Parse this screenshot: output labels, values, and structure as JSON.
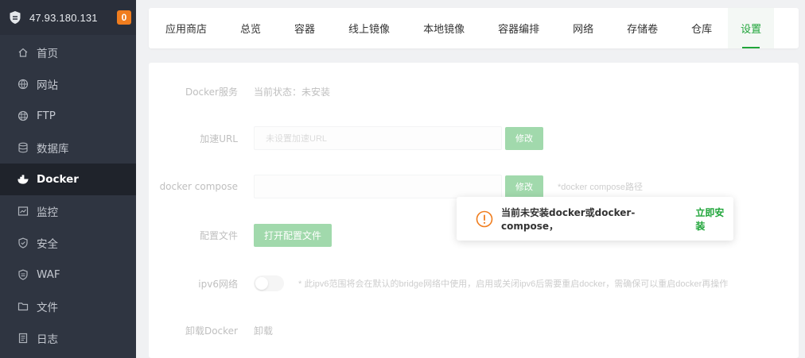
{
  "header": {
    "server_ip": "47.93.180.131",
    "badge_count": "0",
    "badge_color": "#f07d1e"
  },
  "sidebar": {
    "items": [
      {
        "label": "首页",
        "icon": "home-icon"
      },
      {
        "label": "网站",
        "icon": "globe-icon"
      },
      {
        "label": "FTP",
        "icon": "ftp-globe-icon"
      },
      {
        "label": "数据库",
        "icon": "database-icon"
      },
      {
        "label": "Docker",
        "icon": "docker-whale-icon",
        "active": true
      },
      {
        "label": "监控",
        "icon": "monitor-icon"
      },
      {
        "label": "安全",
        "icon": "shield-check-icon"
      },
      {
        "label": "WAF",
        "icon": "waf-shield-icon"
      },
      {
        "label": "文件",
        "icon": "folder-icon"
      },
      {
        "label": "日志",
        "icon": "log-icon"
      }
    ]
  },
  "tabs": [
    {
      "label": "应用商店"
    },
    {
      "label": "总览"
    },
    {
      "label": "容器"
    },
    {
      "label": "线上镜像"
    },
    {
      "label": "本地镜像"
    },
    {
      "label": "容器编排"
    },
    {
      "label": "网络"
    },
    {
      "label": "存储卷"
    },
    {
      "label": "仓库"
    },
    {
      "label": "设置",
      "active": true
    }
  ],
  "settings": {
    "docker_service": {
      "label": "Docker服务",
      "status": "当前状态：未安装"
    },
    "mirror_url": {
      "label": "加速URL",
      "placeholder": "未设置加速URL",
      "button": "修改"
    },
    "docker_compose": {
      "label": "docker compose",
      "value": "",
      "button": "修改",
      "hint": "*docker compose路径"
    },
    "config_file": {
      "label": "配置文件",
      "button": "打开配置文件"
    },
    "ipv6": {
      "label": "ipv6网络",
      "enabled": false,
      "hint": "* 此ipv6范围将会在默认的bridge网络中使用，启用或关闭ipv6后需要重启docker，需确保可以重启docker再操作"
    },
    "uninstall": {
      "label": "卸载Docker",
      "button": "卸载"
    }
  },
  "notice": {
    "message": "当前未安装docker或docker-compose，",
    "action": "立即安装",
    "icon": "warning-circle-icon"
  },
  "colors": {
    "accent": "#20a53a",
    "warning": "#f07d1e",
    "sidebar_bg": "#2f3541"
  }
}
